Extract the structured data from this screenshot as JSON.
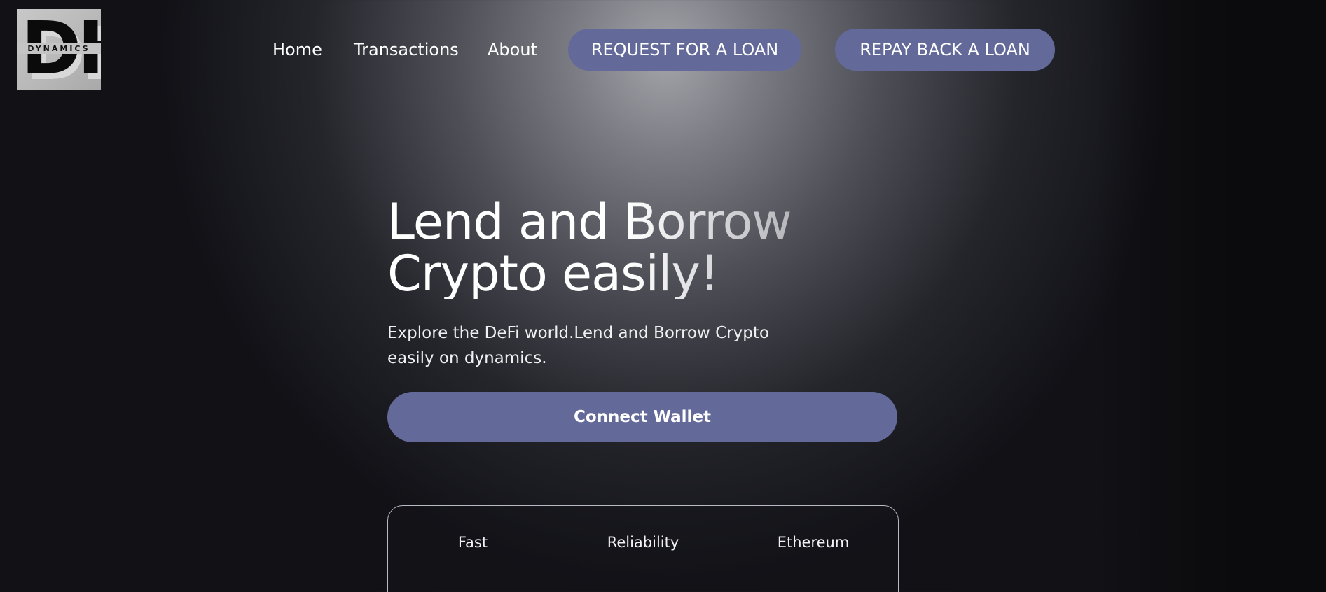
{
  "logo": {
    "letters": "DH",
    "word": "DYNAMICS"
  },
  "nav": {
    "links": [
      "Home",
      "Transactions",
      "About"
    ],
    "request_loan": "REQUEST FOR A LOAN",
    "repay_loan": "REPAY BACK A LOAN"
  },
  "hero": {
    "title_line1": "Lend and Borrow",
    "title_line2": "Crypto easily!",
    "subtitle_line1": "Explore the DeFi world.Lend and Borrow Crypto",
    "subtitle_line2": "easily on dynamics.",
    "connect_label": "Connect Wallet"
  },
  "features": [
    "Fast",
    "Reliability",
    "Ethereum"
  ],
  "colors": {
    "accent": "#636a9a",
    "background": "#0f0f13",
    "grid_border": "#b9bbc4"
  }
}
